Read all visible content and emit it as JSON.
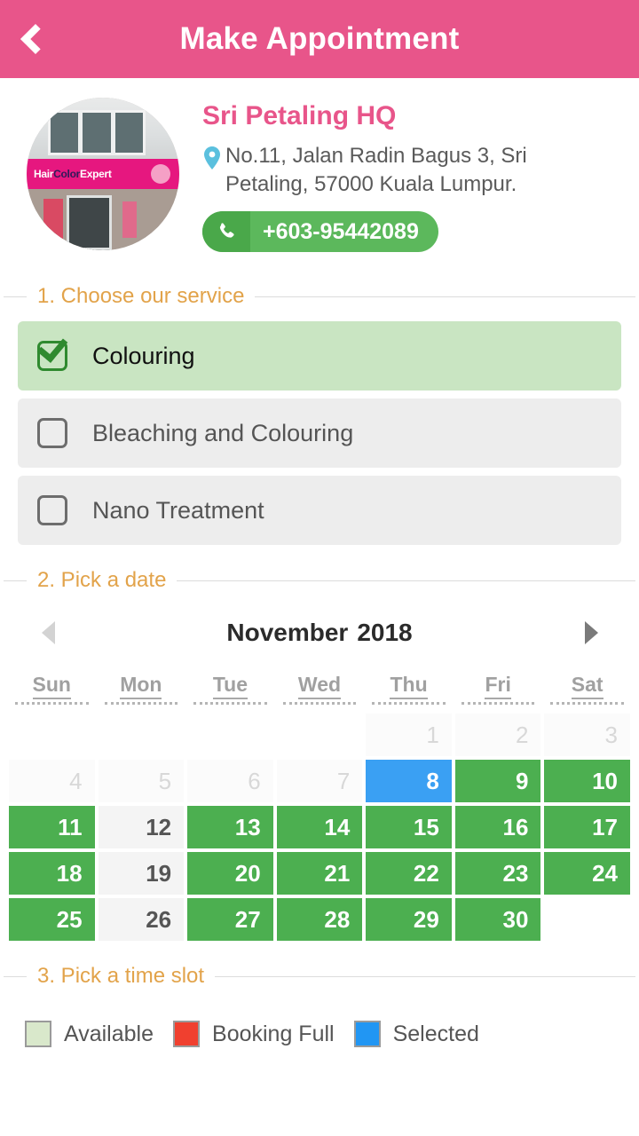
{
  "header": {
    "title": "Make Appointment",
    "back_icon": "chevron-left-icon",
    "background": "#e8558a"
  },
  "salon": {
    "name": "Sri Petaling HQ",
    "photo_alt": "HairColorExpert storefront",
    "photo_sign_text_1": "Hair",
    "photo_sign_text_2": "Color",
    "photo_sign_text_3": "Expert",
    "location_icon": "map-pin-icon",
    "address": "No.11, Jalan Radin Bagus 3, Sri Petaling, 57000 Kuala Lumpur.",
    "phone_icon": "phone-icon",
    "phone": "+603-95442089",
    "name_color": "#e8558a",
    "pin_color": "#5bc0de",
    "phone_button_color": "#5cb85c"
  },
  "sections": {
    "service": "1. Choose our service",
    "date": "2. Pick a date",
    "timeslot": "3. Pick a time slot",
    "heading_color": "#e2a34a"
  },
  "services": [
    {
      "label": "Colouring",
      "checked": true
    },
    {
      "label": "Bleaching and Colouring",
      "checked": false
    },
    {
      "label": "Nano Treatment",
      "checked": false
    }
  ],
  "calendar": {
    "month": "November",
    "year": "2018",
    "prev_icon": "triangle-left-icon",
    "next_icon": "triangle-right-icon",
    "prev_enabled": false,
    "next_enabled": true,
    "day_headers": [
      "Sun",
      "Mon",
      "Tue",
      "Wed",
      "Thu",
      "Fri",
      "Sat"
    ],
    "leading_blanks": 4,
    "days": [
      {
        "n": 1,
        "state": "past"
      },
      {
        "n": 2,
        "state": "past"
      },
      {
        "n": 3,
        "state": "past"
      },
      {
        "n": 4,
        "state": "past"
      },
      {
        "n": 5,
        "state": "past"
      },
      {
        "n": 6,
        "state": "past"
      },
      {
        "n": 7,
        "state": "past"
      },
      {
        "n": 8,
        "state": "selected"
      },
      {
        "n": 9,
        "state": "avail"
      },
      {
        "n": 10,
        "state": "avail"
      },
      {
        "n": 11,
        "state": "avail"
      },
      {
        "n": 12,
        "state": "closed"
      },
      {
        "n": 13,
        "state": "avail"
      },
      {
        "n": 14,
        "state": "avail"
      },
      {
        "n": 15,
        "state": "avail"
      },
      {
        "n": 16,
        "state": "avail"
      },
      {
        "n": 17,
        "state": "avail"
      },
      {
        "n": 18,
        "state": "avail"
      },
      {
        "n": 19,
        "state": "closed"
      },
      {
        "n": 20,
        "state": "avail"
      },
      {
        "n": 21,
        "state": "avail"
      },
      {
        "n": 22,
        "state": "avail"
      },
      {
        "n": 23,
        "state": "avail"
      },
      {
        "n": 24,
        "state": "avail"
      },
      {
        "n": 25,
        "state": "avail"
      },
      {
        "n": 26,
        "state": "closed"
      },
      {
        "n": 27,
        "state": "avail"
      },
      {
        "n": 28,
        "state": "avail"
      },
      {
        "n": 29,
        "state": "avail"
      },
      {
        "n": 30,
        "state": "avail"
      }
    ],
    "colors": {
      "available": "#4caf50",
      "selected": "#3aa0f3",
      "closed": "#f4f4f4",
      "past": "#fbfbfb"
    }
  },
  "legend": [
    {
      "label": "Available",
      "color": "#d9e8cb"
    },
    {
      "label": "Booking Full",
      "color": "#f0402f"
    },
    {
      "label": "Selected",
      "color": "#2196f3"
    }
  ]
}
